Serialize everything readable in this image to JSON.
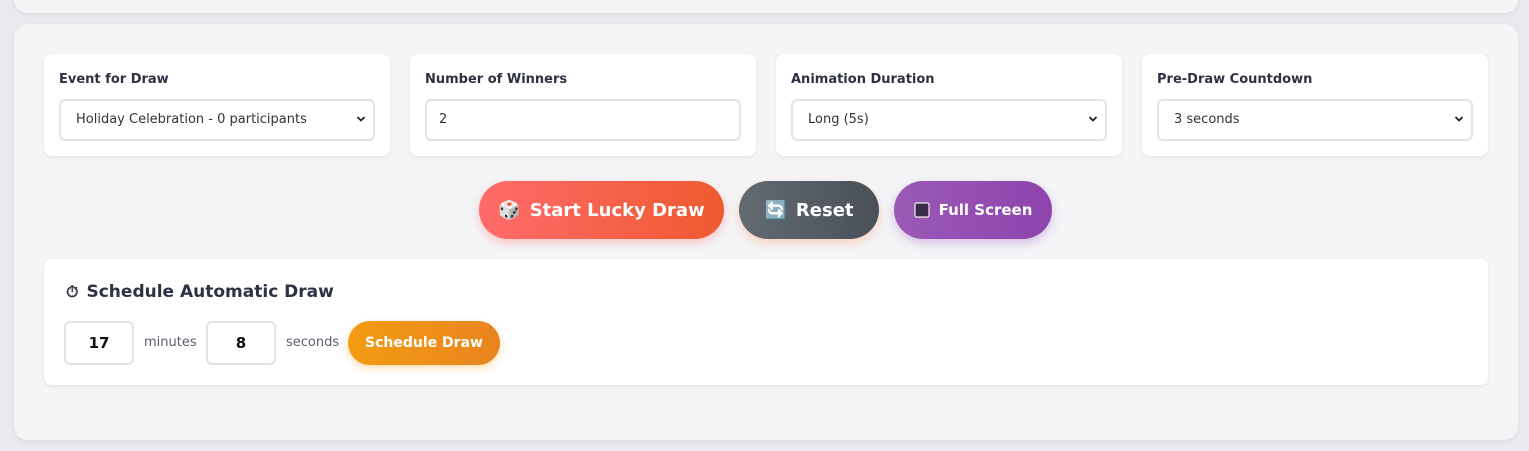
{
  "controls": {
    "event": {
      "label": "Event for Draw",
      "value": "Holiday Celebration - 0 participants"
    },
    "winners": {
      "label": "Number of Winners",
      "value": "2"
    },
    "animation": {
      "label": "Animation Duration",
      "value": "Long (5s)"
    },
    "countdown": {
      "label": "Pre-Draw Countdown",
      "value": "3 seconds"
    }
  },
  "actions": {
    "start": {
      "icon": "🎲",
      "label": "Start Lucky Draw",
      "color": "#ff6b6b"
    },
    "reset": {
      "icon": "🔄",
      "label": "Reset",
      "color": "#5a6068"
    },
    "fullscreen": {
      "icon": "square-icon",
      "label": "Full Screen",
      "color": "#9b59b6"
    }
  },
  "schedule": {
    "icon": "⏱",
    "title": "Schedule Automatic Draw",
    "minutes_value": "17",
    "minutes_label": "minutes",
    "seconds_value": "8",
    "seconds_label": "seconds",
    "button_label": "Schedule Draw",
    "button_color": "#f39c12"
  }
}
